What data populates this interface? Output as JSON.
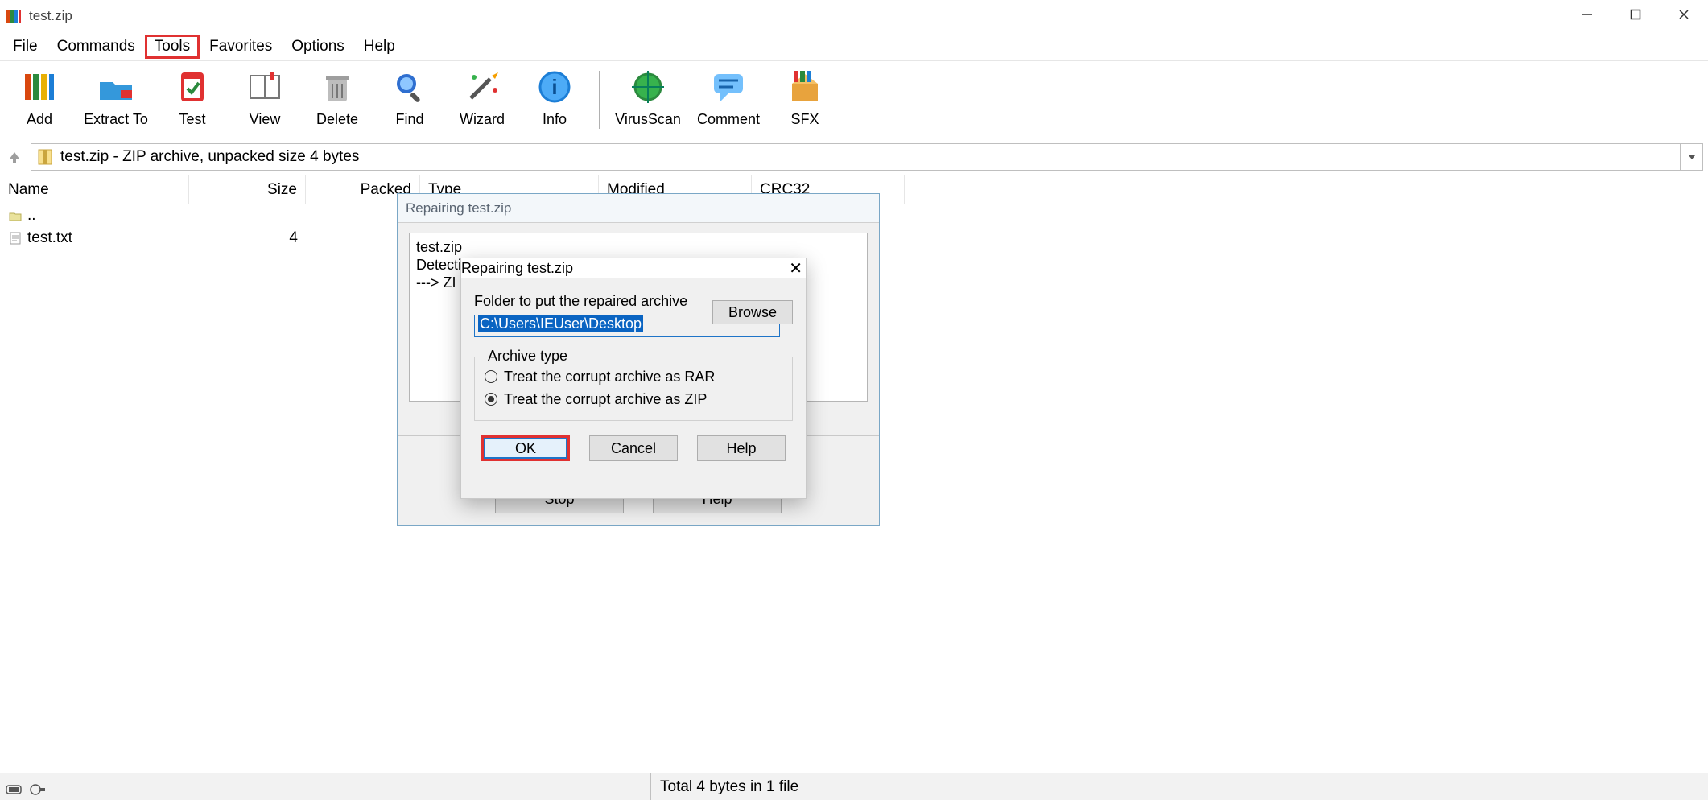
{
  "window": {
    "title": "test.zip",
    "min_tooltip": "Minimize",
    "max_tooltip": "Maximize",
    "close_tooltip": "Close"
  },
  "menu": {
    "file": "File",
    "commands": "Commands",
    "tools": "Tools",
    "favorites": "Favorites",
    "options": "Options",
    "help": "Help"
  },
  "toolbar": {
    "add": "Add",
    "extract": "Extract To",
    "test": "Test",
    "view": "View",
    "delete": "Delete",
    "find": "Find",
    "wizard": "Wizard",
    "info": "Info",
    "virus": "VirusScan",
    "comment": "Comment",
    "sfx": "SFX"
  },
  "address": {
    "text": "test.zip - ZIP archive, unpacked size 4 bytes"
  },
  "columns": {
    "name": "Name",
    "size": "Size",
    "packed": "Packed",
    "type": "Type",
    "modified": "Modified",
    "crc": "CRC32"
  },
  "rows": [
    {
      "name": "..",
      "size": "",
      "icon": "folder-up"
    },
    {
      "name": "test.txt",
      "size": "4",
      "icon": "text-file"
    }
  ],
  "bg_dialog": {
    "title": "Repairing test.zip",
    "log_line1": "test.zip",
    "log_line2": "Detecti",
    "log_line3": "---> ZI",
    "stop": "Stop",
    "help": "Help"
  },
  "fg_dialog": {
    "title": "Repairing test.zip",
    "folder_label": "Folder to put the repaired archive",
    "browse": "Browse",
    "path": "C:\\Users\\IEUser\\Desktop",
    "fieldset": "Archive type",
    "opt_rar": "Treat the corrupt archive as RAR",
    "opt_zip": "Treat the corrupt archive as ZIP",
    "ok": "OK",
    "cancel": "Cancel",
    "help": "Help"
  },
  "status": {
    "text": "Total 4 bytes in 1 file"
  }
}
